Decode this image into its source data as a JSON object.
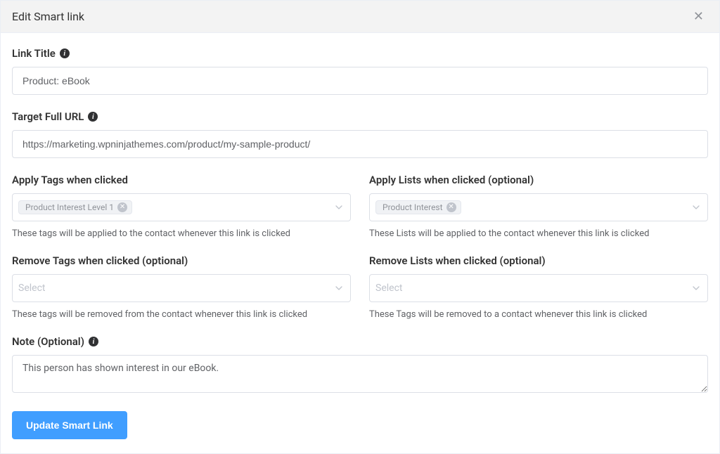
{
  "header": {
    "title": "Edit Smart link"
  },
  "linkTitle": {
    "label": "Link Title",
    "value": "Product: eBook"
  },
  "targetUrl": {
    "label": "Target Full URL",
    "value": "https://marketing.wpninjathemes.com/product/my-sample-product/"
  },
  "applyTags": {
    "label": "Apply Tags when clicked",
    "tag": "Product Interest Level 1",
    "helper": "These tags will be applied to the contact whenever this link is clicked"
  },
  "applyLists": {
    "label": "Apply Lists when clicked (optional)",
    "tag": "Product Interest",
    "helper": "These Lists will be applied to the contact whenever this link is clicked"
  },
  "removeTags": {
    "label": "Remove Tags when clicked (optional)",
    "placeholder": "Select",
    "helper": "These tags will be removed from the contact whenever this link is clicked"
  },
  "removeLists": {
    "label": "Remove Lists when clicked (optional)",
    "placeholder": "Select",
    "helper": "These Tags will be removed to a contact whenever this link is clicked"
  },
  "note": {
    "label": "Note (Optional)",
    "value": "This person has shown interest in our eBook."
  },
  "submit": {
    "label": "Update Smart Link"
  }
}
